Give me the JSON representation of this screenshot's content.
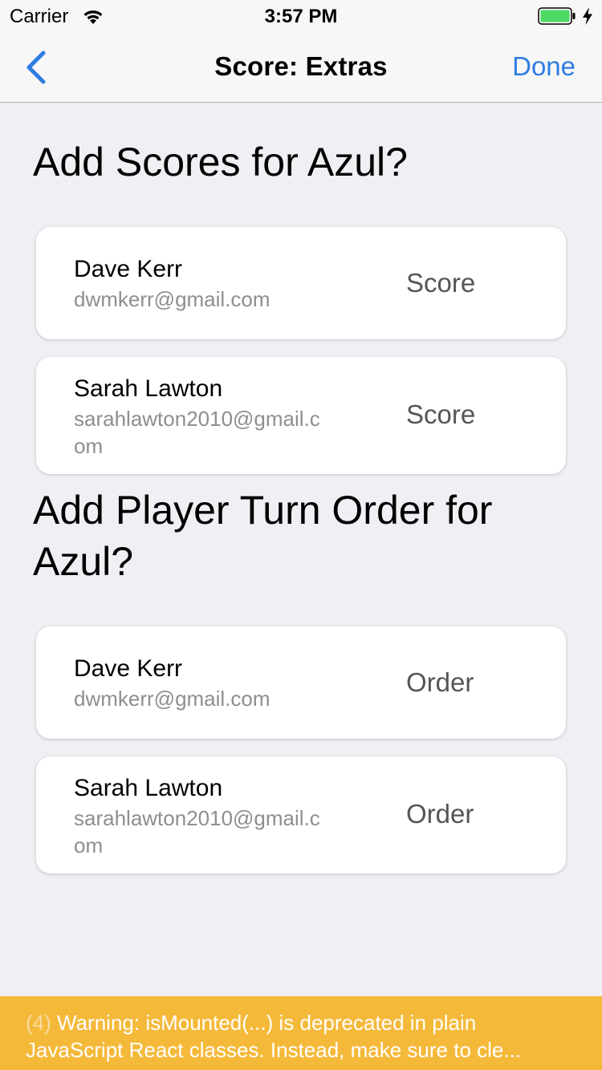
{
  "status_bar": {
    "carrier": "Carrier",
    "time": "3:57 PM",
    "battery_color": "#4cd964"
  },
  "nav": {
    "back_icon": "chevron-left-icon",
    "title": "Score: Extras",
    "done_label": "Done",
    "accent_color": "#2f7de1"
  },
  "scores_section": {
    "title": "Add Scores for Azul?",
    "players": [
      {
        "name": "Dave Kerr",
        "email": "dwmkerr@gmail.com",
        "action": "Score"
      },
      {
        "name": "Sarah Lawton",
        "email_line1": "sarahlawton2010@gmail.c",
        "email_line2": "om",
        "action": "Score"
      }
    ]
  },
  "order_section": {
    "title_line1": "Add Player Turn Order for",
    "title_line2": "Azul?",
    "players": [
      {
        "name": "Dave Kerr",
        "email": "dwmkerr@gmail.com",
        "action": "Order"
      },
      {
        "name": "Sarah Lawton",
        "email_line1": "sarahlawton2010@gmail.c",
        "email_line2": "om",
        "action": "Order"
      }
    ]
  },
  "warning": {
    "count": "(4)",
    "line1": "Warning: isMounted(...) is deprecated in plain",
    "line2": "JavaScript React classes. Instead, make sure to cle...",
    "background_color": "#f5b93a"
  }
}
